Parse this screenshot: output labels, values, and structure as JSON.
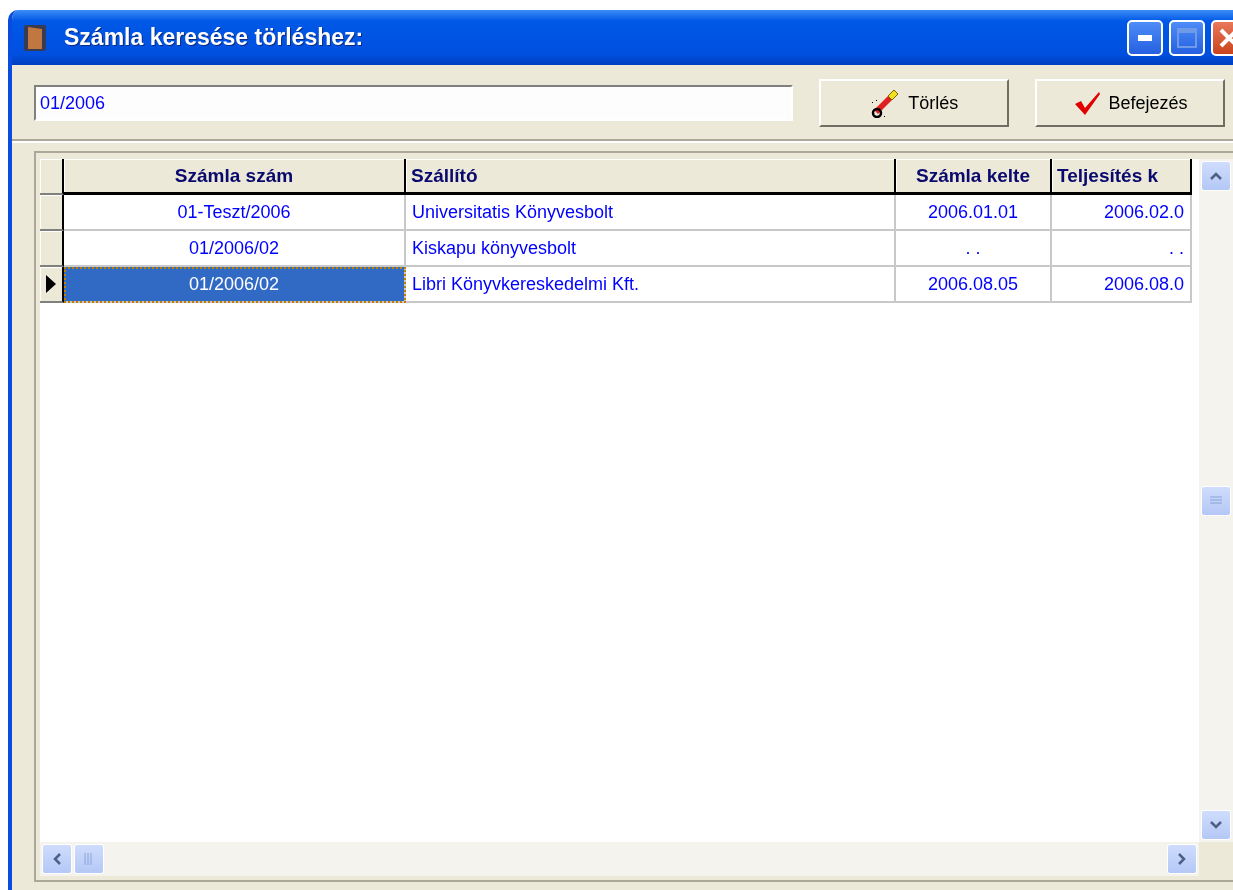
{
  "window": {
    "title": "Számla keresése törléshez:"
  },
  "search": {
    "value": "01/2006"
  },
  "buttons": [
    {
      "kind": "erase",
      "label": "Törlés"
    },
    {
      "kind": "finish",
      "label": "Befejezés"
    }
  ],
  "table": {
    "columns": [
      "Számla szám",
      "Szállító",
      "Számla kelte",
      "Teljesítés k"
    ],
    "rows": [
      {
        "selected": false,
        "cells": [
          "01-Teszt/2006",
          "Universitatis Könyvesbolt",
          "2006.01.01",
          "2006.02.0"
        ]
      },
      {
        "selected": false,
        "cells": [
          "01/2006/02",
          "Kiskapu könyvesbolt",
          ". .",
          ". ."
        ]
      },
      {
        "selected": true,
        "cells": [
          "01/2006/02",
          "Libri Könyvkereskedelmi Kft.",
          "2006.08.05",
          "2006.08.0"
        ]
      }
    ]
  }
}
